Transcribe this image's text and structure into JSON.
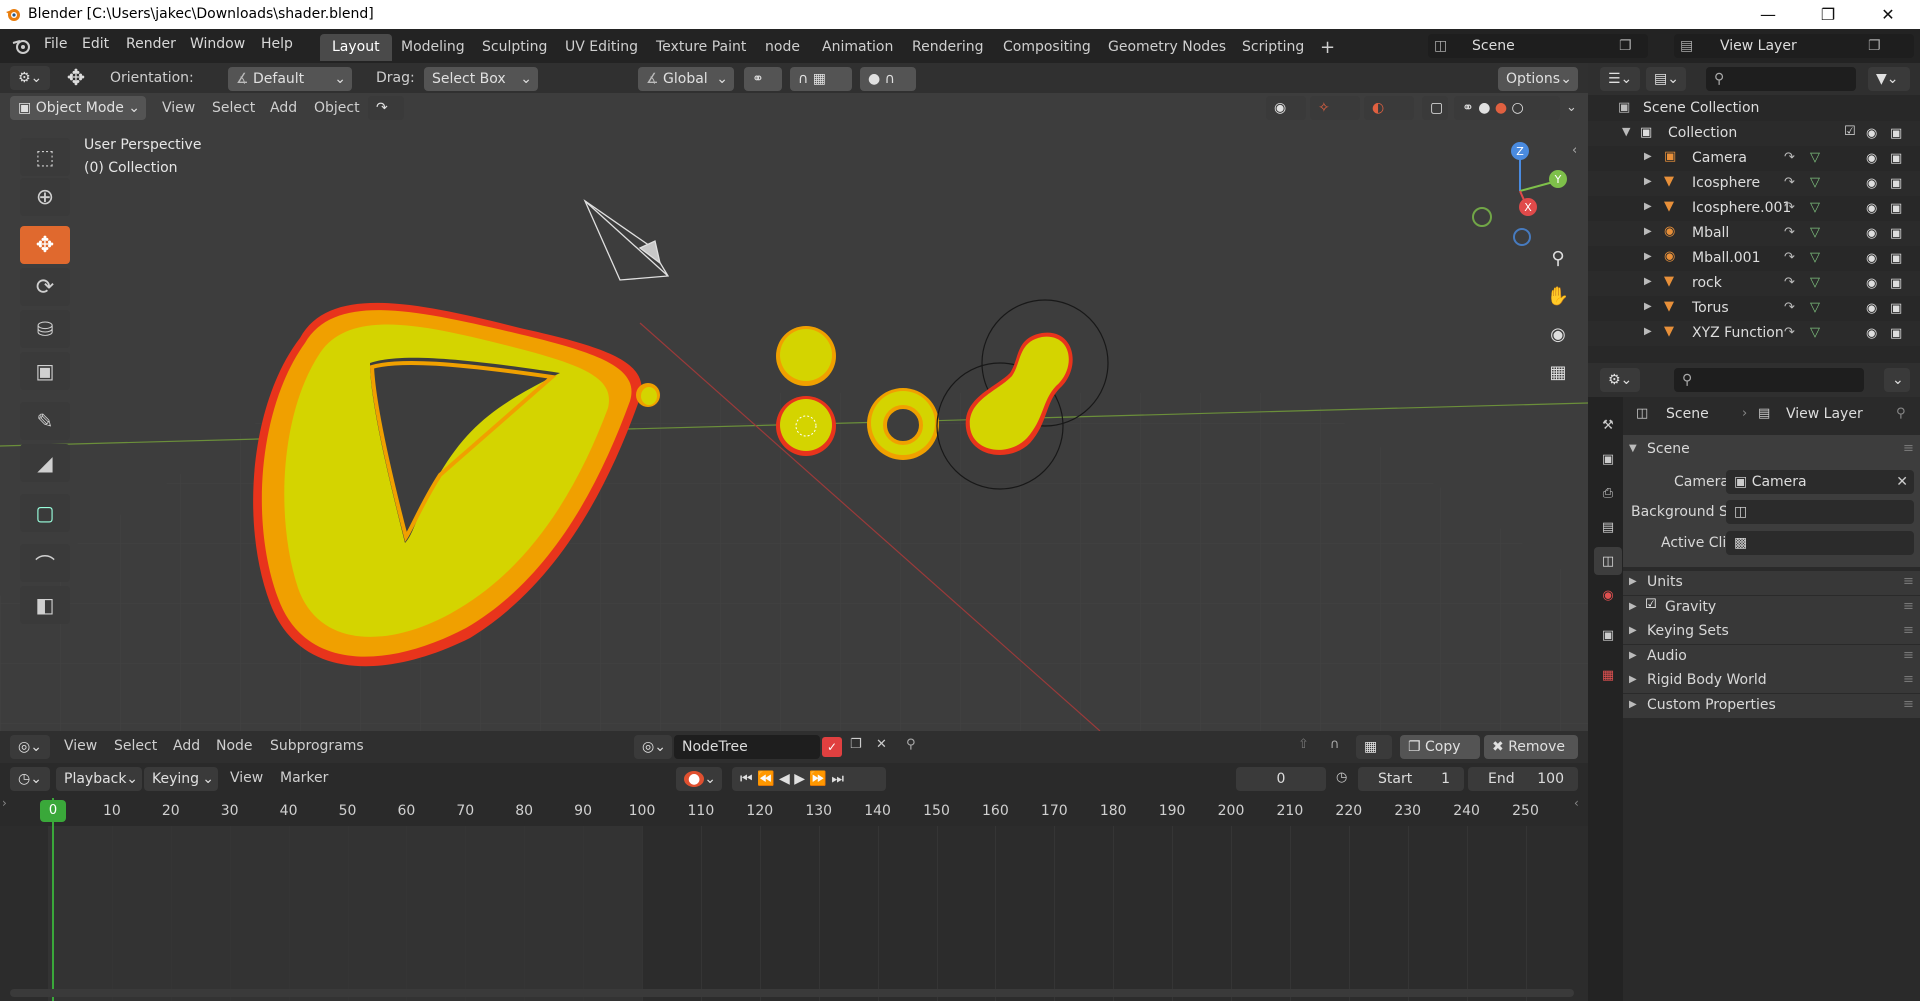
{
  "window": {
    "title": "Blender [C:\\Users\\jakec\\Downloads\\shader.blend]",
    "controls": [
      "minimize",
      "maximize",
      "close"
    ]
  },
  "menu": {
    "items": [
      "File",
      "Edit",
      "Render",
      "Window",
      "Help"
    ]
  },
  "workspaces": {
    "tabs": [
      "Layout",
      "Modeling",
      "Sculpting",
      "UV Editing",
      "Texture Paint",
      "node",
      "Animation",
      "Rendering",
      "Compositing",
      "Geometry Nodes",
      "Scripting"
    ],
    "active": "Layout",
    "add": "+"
  },
  "scene_selector": {
    "value": "Scene"
  },
  "view_layer_selector": {
    "value": "View Layer"
  },
  "viewport_header": {
    "orientation_label": "Orientation:",
    "orientation_value": "Default",
    "drag_label": "Drag:",
    "drag_value": "Select Box",
    "transform_value": "Global",
    "options": "Options"
  },
  "viewport_menu": {
    "mode": "Object Mode",
    "items": [
      "View",
      "Select",
      "Add",
      "Object"
    ]
  },
  "viewport": {
    "overlay_title": "User Perspective",
    "overlay_subtitle": "(0) Collection",
    "gizmo_axes": {
      "z": "Z",
      "y": "Y",
      "x": "X"
    },
    "colors": {
      "background": "#3d3d3d",
      "object_yellow": "#d4d400",
      "outline": "#e83a1a",
      "active_tool": "#e0692e"
    }
  },
  "node_editor_header": {
    "items": [
      "View",
      "Select",
      "Add",
      "Node",
      "Subprograms"
    ],
    "node_tree": "NodeTree",
    "copy": "Copy",
    "remove": "Remove"
  },
  "timeline_header": {
    "playback": "Playback",
    "keying": "Keying",
    "view": "View",
    "marker": "Marker",
    "current_frame": "0",
    "start_label": "Start",
    "start_value": "1",
    "end_label": "End",
    "end_value": "100"
  },
  "timeline": {
    "ticks": [
      "0",
      "10",
      "20",
      "30",
      "40",
      "50",
      "60",
      "70",
      "80",
      "90",
      "100",
      "110",
      "120",
      "130",
      "140",
      "150",
      "160",
      "170",
      "180",
      "190",
      "200",
      "210",
      "220",
      "230",
      "240",
      "250"
    ],
    "playhead": "0"
  },
  "outliner": {
    "root": "Scene Collection",
    "collection": "Collection",
    "items": [
      {
        "name": "Camera"
      },
      {
        "name": "Icosphere"
      },
      {
        "name": "Icosphere.001"
      },
      {
        "name": "Mball"
      },
      {
        "name": "Mball.001"
      },
      {
        "name": "rock"
      },
      {
        "name": "Torus"
      },
      {
        "name": "XYZ Function"
      }
    ]
  },
  "properties": {
    "breadcrumb_scene": "Scene",
    "breadcrumb_view_layer": "View Layer",
    "panel_title": "Scene",
    "camera_label": "Camera",
    "camera_value": "Camera",
    "background_label": "Background Sc...",
    "active_clip_label": "Active Clip",
    "subpanels": [
      "Units",
      "Gravity",
      "Keying Sets",
      "Audio",
      "Rigid Body World",
      "Custom Properties"
    ]
  }
}
